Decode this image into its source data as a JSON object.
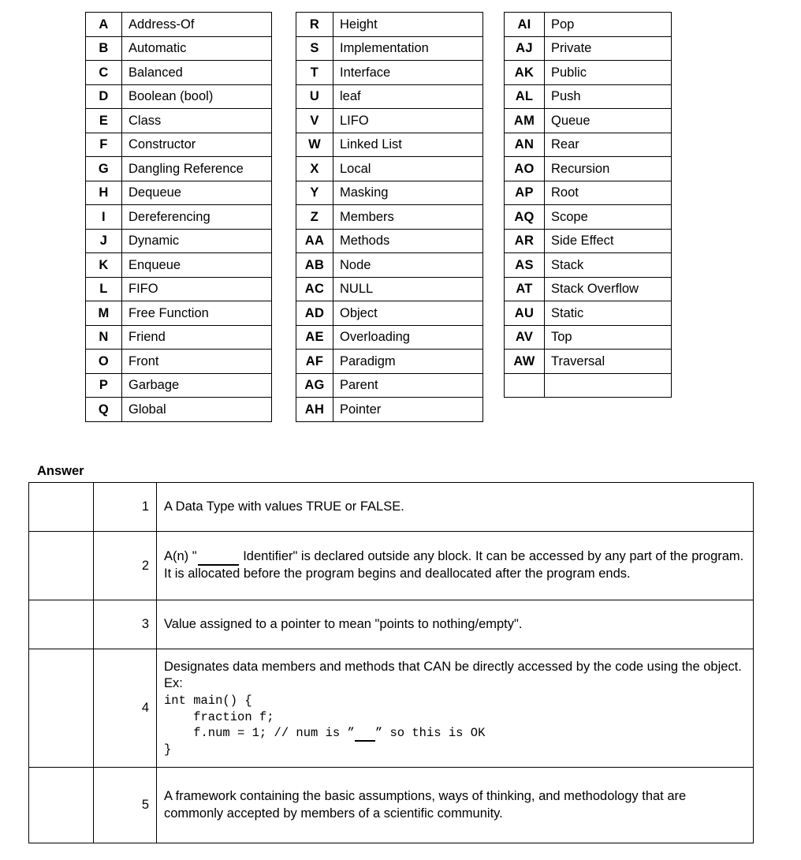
{
  "wordbank": {
    "columns": [
      {
        "id": "column-1",
        "rows": [
          {
            "key": "A",
            "term": "Address-Of"
          },
          {
            "key": "B",
            "term": "Automatic"
          },
          {
            "key": "C",
            "term": "Balanced"
          },
          {
            "key": "D",
            "term": "Boolean (bool)"
          },
          {
            "key": "E",
            "term": "Class"
          },
          {
            "key": "F",
            "term": "Constructor"
          },
          {
            "key": "G",
            "term": "Dangling Reference"
          },
          {
            "key": "H",
            "term": "Dequeue"
          },
          {
            "key": "I",
            "term": "Dereferencing"
          },
          {
            "key": "J",
            "term": "Dynamic"
          },
          {
            "key": "K",
            "term": "Enqueue"
          },
          {
            "key": "L",
            "term": "FIFO"
          },
          {
            "key": "M",
            "term": "Free Function"
          },
          {
            "key": "N",
            "term": "Friend"
          },
          {
            "key": "O",
            "term": "Front"
          },
          {
            "key": "P",
            "term": "Garbage"
          },
          {
            "key": "Q",
            "term": "Global"
          }
        ]
      },
      {
        "id": "column-2",
        "rows": [
          {
            "key": "R",
            "term": "Height"
          },
          {
            "key": "S",
            "term": "Implementation"
          },
          {
            "key": "T",
            "term": "Interface"
          },
          {
            "key": "U",
            "term": "leaf"
          },
          {
            "key": "V",
            "term": "LIFO"
          },
          {
            "key": "W",
            "term": "Linked List"
          },
          {
            "key": "X",
            "term": "Local"
          },
          {
            "key": "Y",
            "term": "Masking"
          },
          {
            "key": "Z",
            "term": "Members"
          },
          {
            "key": "AA",
            "term": "Methods"
          },
          {
            "key": "AB",
            "term": "Node"
          },
          {
            "key": "AC",
            "term": "NULL"
          },
          {
            "key": "AD",
            "term": "Object"
          },
          {
            "key": "AE",
            "term": "Overloading"
          },
          {
            "key": "AF",
            "term": "Paradigm"
          },
          {
            "key": "AG",
            "term": "Parent"
          },
          {
            "key": "AH",
            "term": "Pointer"
          }
        ]
      },
      {
        "id": "column-3",
        "rows": [
          {
            "key": "AI",
            "term": "Pop"
          },
          {
            "key": "AJ",
            "term": "Private"
          },
          {
            "key": "AK",
            "term": "Public"
          },
          {
            "key": "AL",
            "term": "Push"
          },
          {
            "key": "AM",
            "term": "Queue"
          },
          {
            "key": "AN",
            "term": "Rear"
          },
          {
            "key": "AO",
            "term": "Recursion"
          },
          {
            "key": "AP",
            "term": "Root"
          },
          {
            "key": "AQ",
            "term": "Scope"
          },
          {
            "key": "AR",
            "term": "Side Effect"
          },
          {
            "key": "AS",
            "term": "Stack"
          },
          {
            "key": "AT",
            "term": "Stack Overflow"
          },
          {
            "key": "AU",
            "term": "Static"
          },
          {
            "key": "AV",
            "term": "Top"
          },
          {
            "key": "AW",
            "term": "Traversal"
          },
          {
            "key": "",
            "term": ""
          }
        ]
      }
    ]
  },
  "answer_section": {
    "heading": "Answer",
    "rows": [
      {
        "answer": "",
        "number": "1",
        "lines": [
          "A Data Type with values TRUE or FALSE."
        ]
      },
      {
        "answer": "",
        "number": "2",
        "prefix": "A(n) \"",
        "suffix": " Identifier\" is declared outside any block. It can be accessed by any part of the program. It is allocated before the program begins and deallocated after the program ends."
      },
      {
        "answer": "",
        "number": "3",
        "lines": [
          "Value assigned to a pointer to mean \"points to nothing/empty\"."
        ]
      },
      {
        "answer": "",
        "number": "4",
        "lines": [
          "Designates data members and methods that CAN be directly accessed by the code using the object. Ex:"
        ],
        "code_before": "int main() {\n    fraction f;\n    f.num = 1; // num is ”",
        "code_after": "” so this is OK\n}"
      },
      {
        "answer": "",
        "number": "5",
        "lines": [
          "A framework containing the basic assumptions, ways of thinking, and methodology that are commonly accepted by members of a scientific community."
        ]
      }
    ]
  }
}
